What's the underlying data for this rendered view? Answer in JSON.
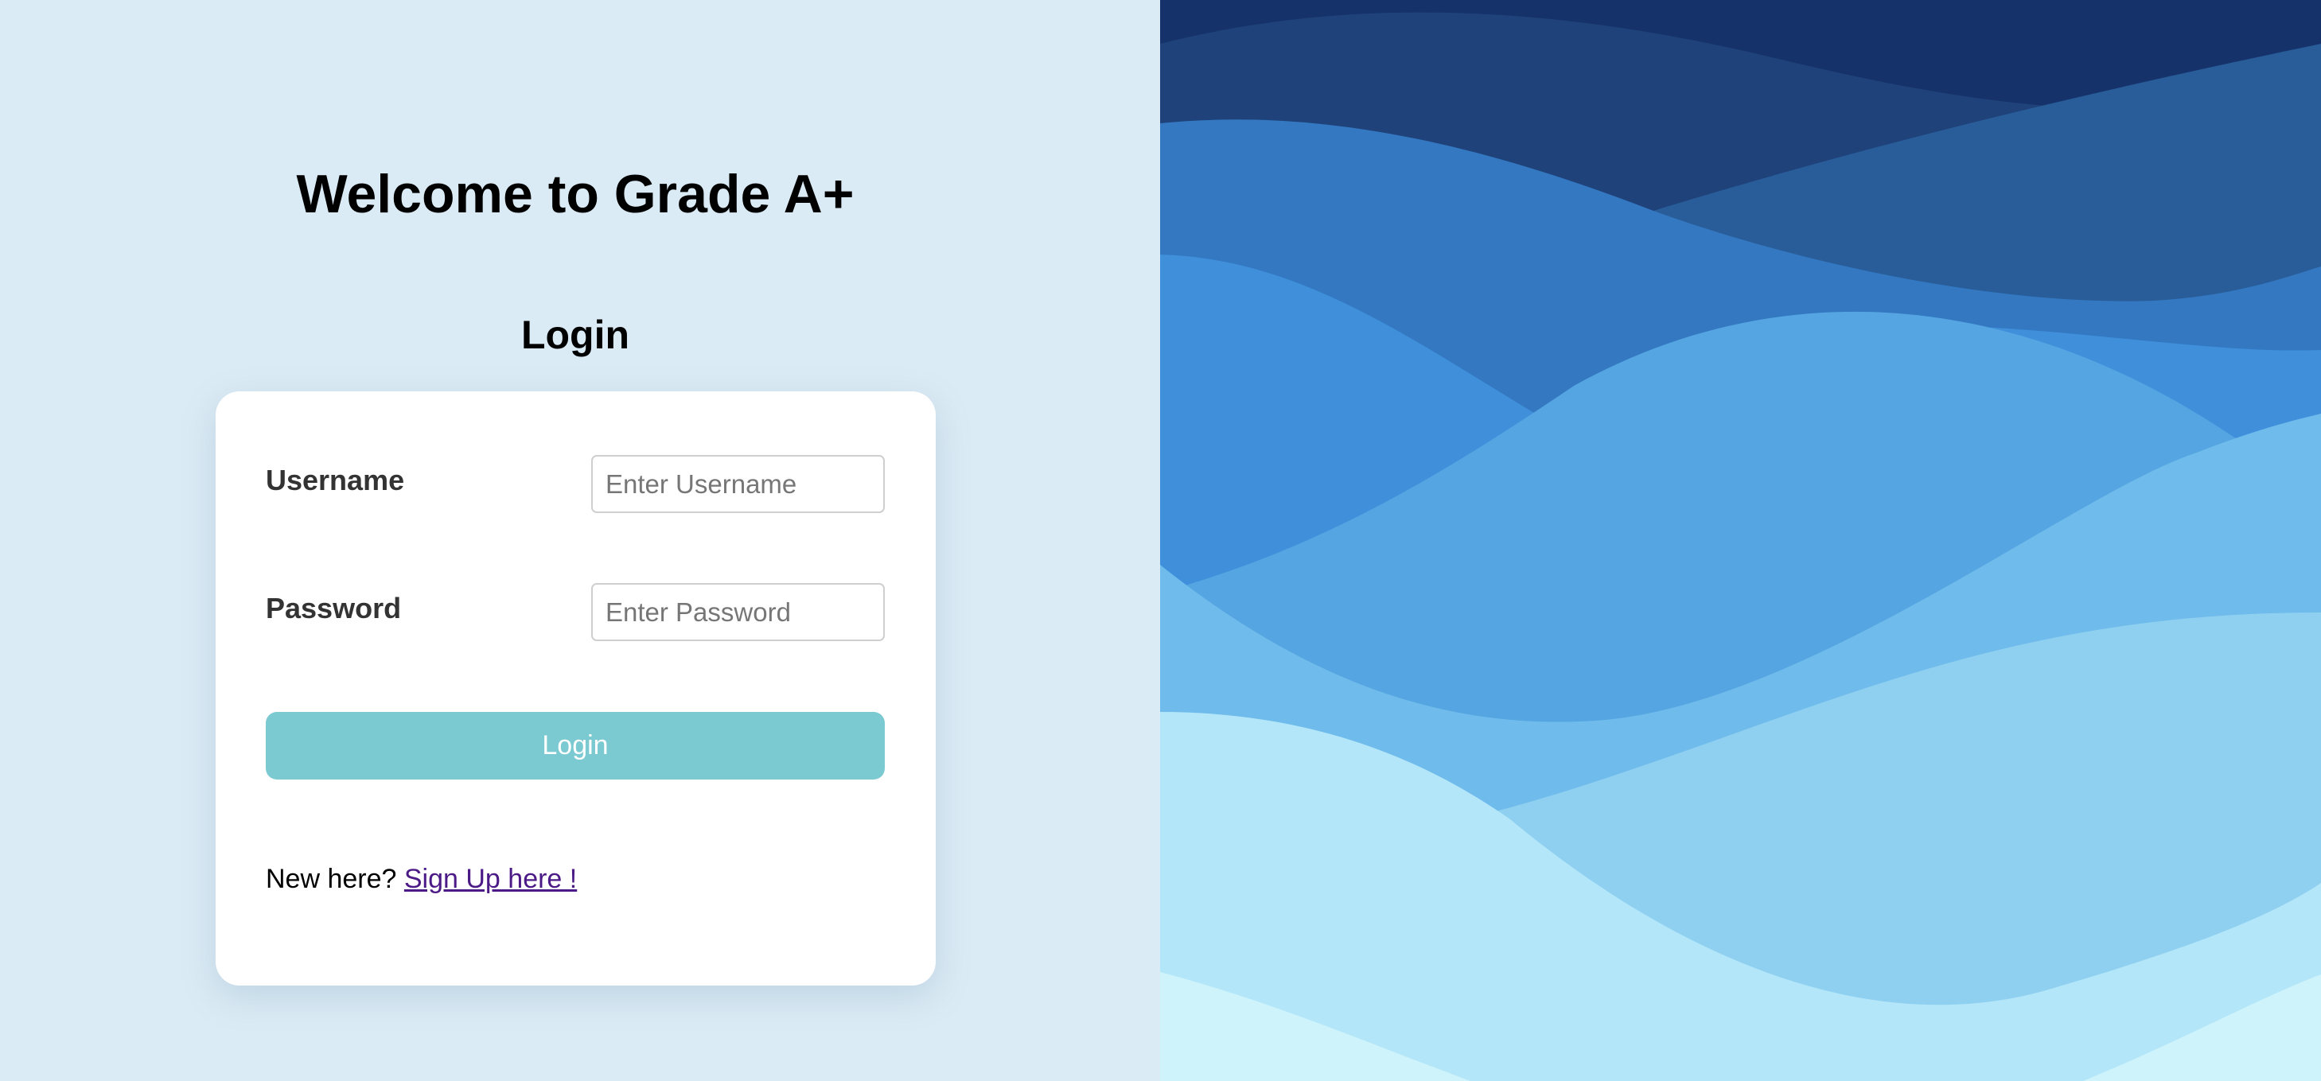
{
  "welcome": {
    "title": "Welcome to Grade A+"
  },
  "login_heading": "Login",
  "form": {
    "username_label": "Username",
    "username_placeholder": "Enter Username",
    "username_value": "",
    "password_label": "Password",
    "password_placeholder": "Enter Password",
    "password_value": "",
    "login_button": "Login"
  },
  "signup": {
    "prompt": "New here?",
    "link_text": "Sign Up here !"
  },
  "colors": {
    "left_background": "#dbebf5",
    "button": "#7bc9d1",
    "link": "#4b1a87",
    "wave_darkest": "#16326a",
    "wave_lightest": "#cff3fa"
  }
}
